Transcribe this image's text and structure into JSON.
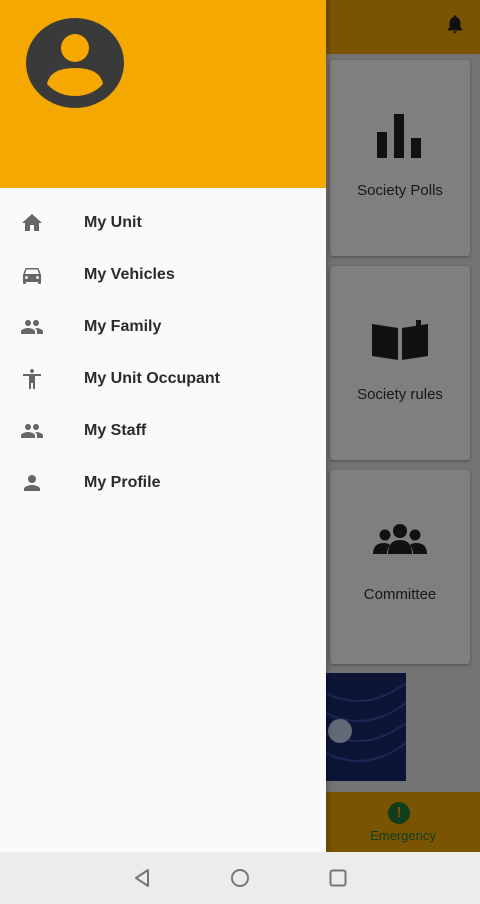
{
  "background_app": {
    "cards": [
      {
        "label": "Society Polls",
        "icon": "bar-chart-icon"
      },
      {
        "label": "Society rules",
        "icon": "book-icon"
      },
      {
        "label": "Committee",
        "icon": "group-icon"
      }
    ],
    "bottom_nav": {
      "label": "Emergency",
      "icon": "alert-icon"
    },
    "notification_icon": "bell-icon"
  },
  "drawer": {
    "header_color": "#f5a800",
    "avatar_icon": "account-circle-icon",
    "items": [
      {
        "label": "My Unit",
        "icon": "home-icon"
      },
      {
        "label": "My Vehicles",
        "icon": "car-icon"
      },
      {
        "label": "My Family",
        "icon": "people-icon"
      },
      {
        "label": "My Unit Occupant",
        "icon": "person-standing-icon"
      },
      {
        "label": "My Staff",
        "icon": "people-icon"
      },
      {
        "label": "My Profile",
        "icon": "person-icon"
      }
    ]
  },
  "system_nav": {
    "buttons": [
      "back-icon",
      "home-circle-icon",
      "recents-icon"
    ]
  },
  "colors": {
    "accent": "#f5a800",
    "drawer_bg": "#fafafa",
    "icon_gray": "#666666"
  }
}
